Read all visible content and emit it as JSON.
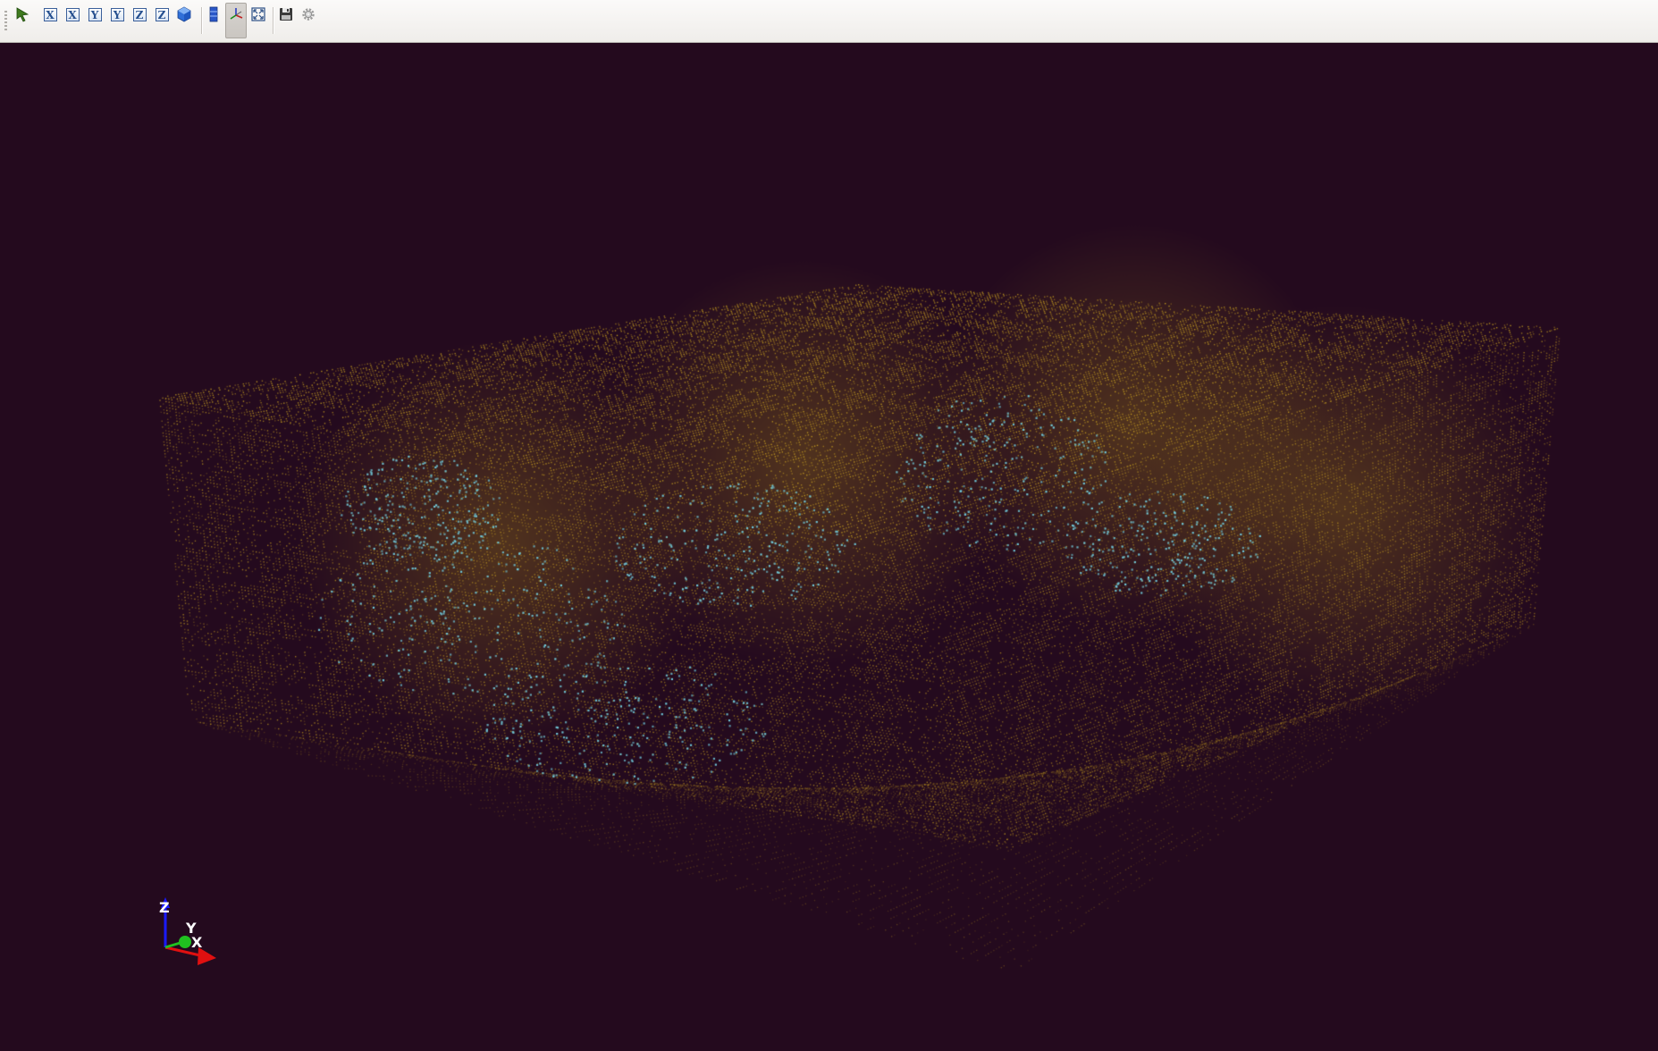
{
  "toolbar": {
    "buttons": [
      {
        "name": "select-tool-icon",
        "label": ""
      },
      {
        "name": "view-x-positive-button",
        "label": "X"
      },
      {
        "name": "view-x-negative-button",
        "label": "X"
      },
      {
        "name": "view-y-positive-button",
        "label": "Y"
      },
      {
        "name": "view-y-negative-button",
        "label": "Y"
      },
      {
        "name": "view-z-positive-button",
        "label": "Z"
      },
      {
        "name": "view-z-negative-button",
        "label": "Z"
      },
      {
        "name": "isometric-view-icon",
        "label": ""
      },
      {
        "name": "color-bar-icon",
        "label": ""
      },
      {
        "name": "axes-toggle-icon",
        "label": ""
      },
      {
        "name": "fit-view-icon",
        "label": ""
      },
      {
        "name": "save-icon",
        "label": ""
      },
      {
        "name": "settings-gear-icon",
        "label": ""
      }
    ],
    "active_button": "axes-toggle-icon"
  },
  "viewport": {
    "background_color": "#240a1e",
    "point_colors": {
      "grid": "#c8a020",
      "highlight": "#70c8d8"
    },
    "axes_triad": {
      "x_label": "X",
      "y_label": "Y",
      "z_label": "Z",
      "x_color": "#e01010",
      "y_color": "#20c020",
      "z_color": "#1a1aff"
    }
  }
}
